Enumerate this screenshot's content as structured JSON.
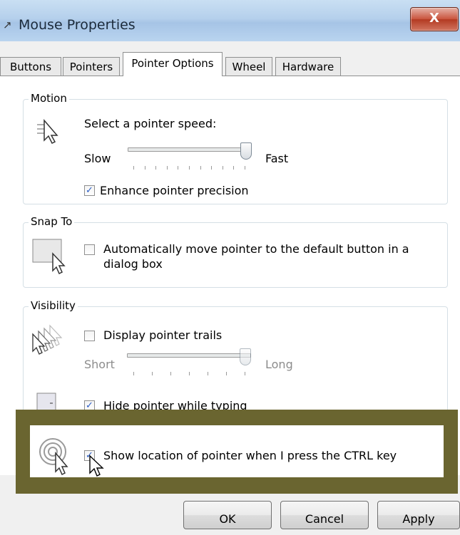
{
  "window": {
    "title": "Mouse Properties",
    "close_glyph": "X"
  },
  "tabs": [
    {
      "label": "Buttons",
      "active": false
    },
    {
      "label": "Pointers",
      "active": false
    },
    {
      "label": "Pointer Options",
      "active": true
    },
    {
      "label": "Wheel",
      "active": false
    },
    {
      "label": "Hardware",
      "active": false
    }
  ],
  "motion": {
    "legend": "Motion",
    "speed_label": "Select a pointer speed:",
    "slow": "Slow",
    "fast": "Fast",
    "speed_level": 1.0,
    "precision_label": "Enhance pointer precision",
    "precision_checked": true
  },
  "snap_to": {
    "legend": "Snap To",
    "label_line1": "Automatically move pointer to the default button in a",
    "label_line2": "dialog box",
    "checked": false
  },
  "visibility": {
    "legend": "Visibility",
    "trails_label": "Display pointer trails",
    "trails_checked": false,
    "short": "Short",
    "long": "Long",
    "trail_level": 1.0,
    "hide_label": "Hide pointer while typing",
    "hide_checked": true,
    "show_label": "Show location of pointer when I press the CTRL key",
    "show_checked": true
  },
  "buttons": {
    "ok": "OK",
    "cancel": "Cancel",
    "apply": "Apply"
  },
  "icons": {
    "app": "mouse-icon",
    "speed": "pointer-speed-icon",
    "snap": "snap-pointer-icon",
    "trails": "pointer-trails-icon",
    "hide": "hide-pointer-icon",
    "locate": "locate-pointer-icon"
  },
  "colors": {
    "overlay": "#6a6530",
    "title_bar": "#b5d0ec",
    "close": "#c9533c"
  }
}
